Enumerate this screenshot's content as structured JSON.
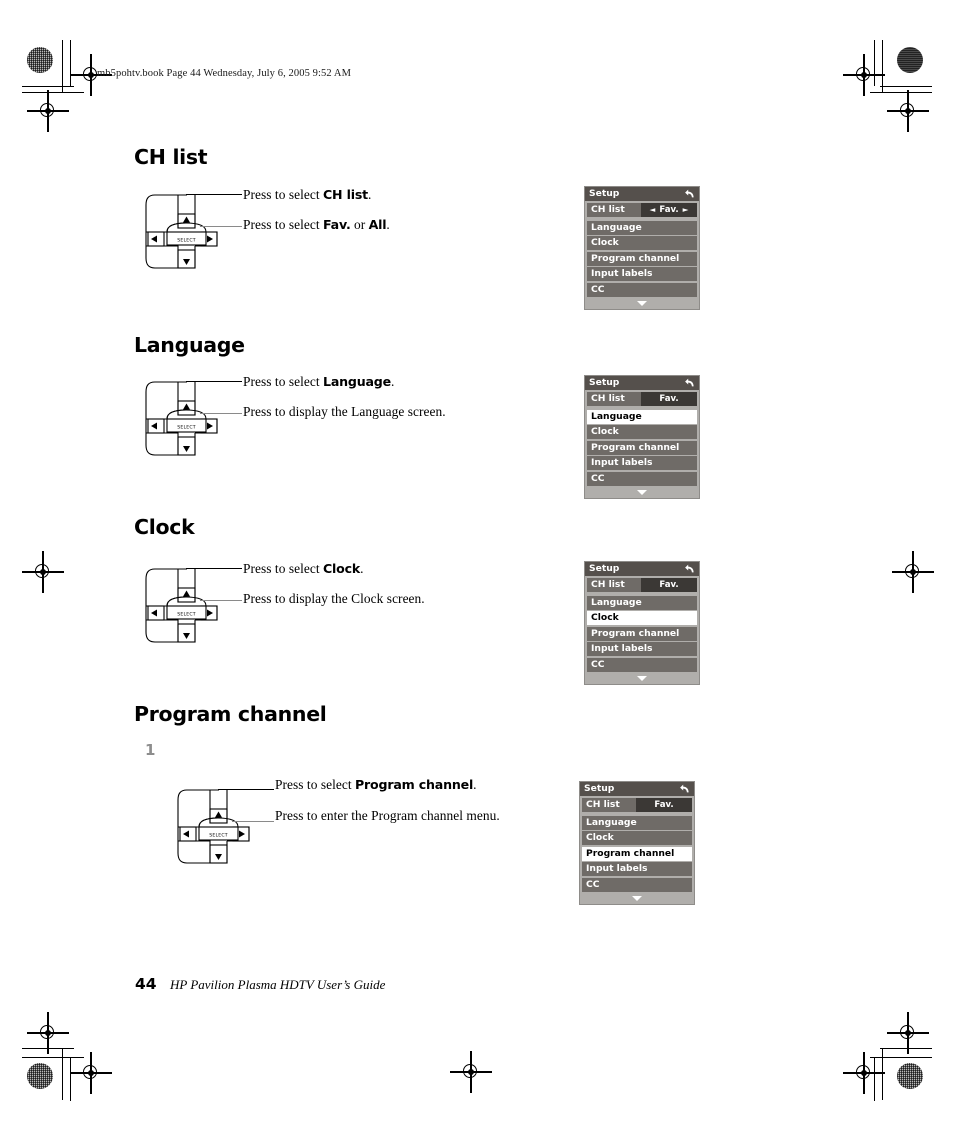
{
  "page": {
    "running_header": "mb5pohtv.book  Page 44  Wednesday, July 6, 2005  9:52 AM",
    "page_number": "44",
    "book_title": "HP Pavilion Plasma HDTV User’s Guide"
  },
  "sections": [
    {
      "heading": "CH list",
      "step": "",
      "instructions": [
        {
          "pre": "Press to select ",
          "bold": "CH list",
          "post": "."
        },
        {
          "pre": "Press to select ",
          "bold": "Fav.",
          "mid": " or ",
          "bold2": "All",
          "post": "."
        }
      ],
      "dpad_label": "SELECT"
    },
    {
      "heading": "Language",
      "step": "",
      "instructions": [
        {
          "pre": "Press to select ",
          "bold": "Language",
          "post": "."
        },
        {
          "pre": "Press to display the Language screen.",
          "bold": "",
          "post": ""
        }
      ],
      "dpad_label": "SELECT"
    },
    {
      "heading": "Clock",
      "step": "",
      "instructions": [
        {
          "pre": "Press to select ",
          "bold": "Clock",
          "post": "."
        },
        {
          "pre": "Press to display the Clock screen.",
          "bold": "",
          "post": ""
        }
      ],
      "dpad_label": "SELECT"
    },
    {
      "heading": "Program channel",
      "step": "1",
      "instructions": [
        {
          "pre": "Press to select ",
          "bold": "Program channel",
          "post": "."
        },
        {
          "pre": "Press to enter the Program channel menu.",
          "bold": "",
          "post": ""
        }
      ],
      "dpad_label": "SELECT"
    }
  ],
  "menus": [
    {
      "title": "Setup",
      "back_icon": "back-arrow-icon",
      "ch_list_label": "CH list",
      "ch_list_value": "Fav.",
      "ch_list_arrows": true,
      "items": [
        "Language",
        "Clock",
        "Program channel",
        "Input labels",
        "CC"
      ],
      "selected": "",
      "scroll_icon": "chevron-down-icon"
    },
    {
      "title": "Setup",
      "back_icon": "back-arrow-icon",
      "ch_list_label": "CH list",
      "ch_list_value": "Fav.",
      "ch_list_arrows": false,
      "items": [
        "Language",
        "Clock",
        "Program channel",
        "Input labels",
        "CC"
      ],
      "selected": "Language",
      "scroll_icon": "chevron-down-icon"
    },
    {
      "title": "Setup",
      "back_icon": "back-arrow-icon",
      "ch_list_label": "CH list",
      "ch_list_value": "Fav.",
      "ch_list_arrows": false,
      "items": [
        "Language",
        "Clock",
        "Program channel",
        "Input labels",
        "CC"
      ],
      "selected": "Clock",
      "scroll_icon": "chevron-down-icon"
    },
    {
      "title": "Setup",
      "back_icon": "back-arrow-icon",
      "ch_list_label": "CH list",
      "ch_list_value": "Fav.",
      "ch_list_arrows": false,
      "items": [
        "Language",
        "Clock",
        "Program channel",
        "Input labels",
        "CC"
      ],
      "selected": "Program channel",
      "scroll_icon": "chevron-down-icon"
    }
  ],
  "colors": {
    "menu_header_bg": "#55504c",
    "menu_row_bg": "#6f6b67",
    "menu_panel_bg": "#b0aeab",
    "menu_value_bg": "#3b3835",
    "selected_bg": "#ffffff",
    "step_number": "#8d8d8d"
  }
}
